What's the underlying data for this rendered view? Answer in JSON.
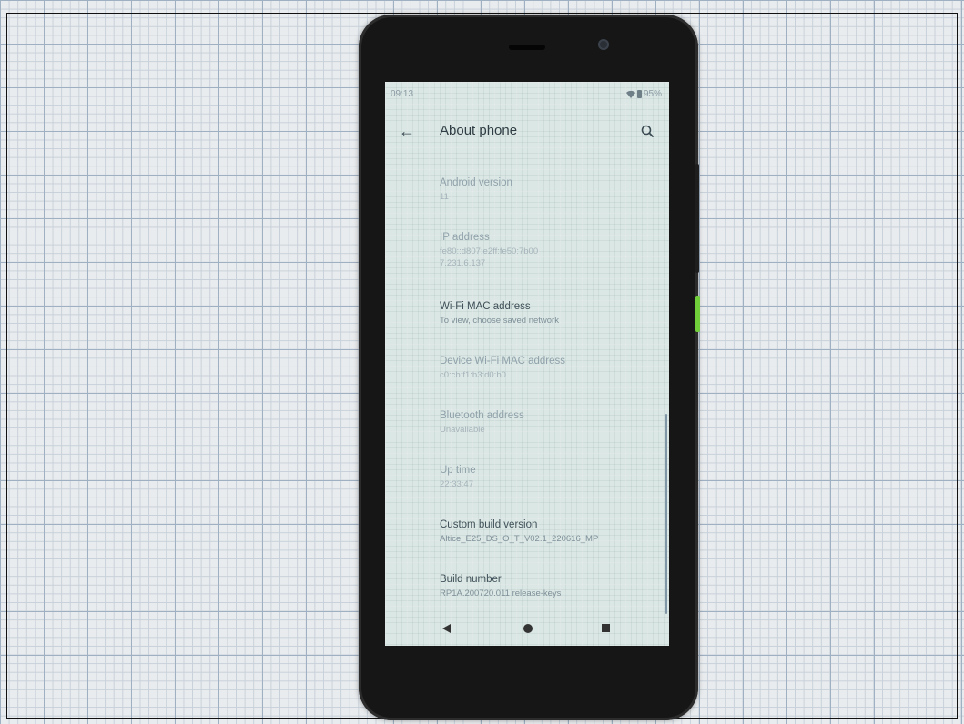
{
  "status_bar": {
    "time": "09:13",
    "battery": "95%"
  },
  "app_bar": {
    "title": "About phone"
  },
  "settings": [
    {
      "title": "Android version",
      "summary": "11"
    },
    {
      "title": "IP address",
      "summary": "fe80::d807:e2ff:fe50:7b00",
      "summary2": "7.231.6.137"
    },
    {
      "title": "Wi-Fi MAC address",
      "summary": "To view, choose saved network"
    },
    {
      "title": "Device Wi-Fi MAC address",
      "summary": "c0:cb:f1:b3:d0:b0"
    },
    {
      "title": "Bluetooth address",
      "summary": "Unavailable"
    },
    {
      "title": "Up time",
      "summary": "22:33:47"
    },
    {
      "title": "Custom build version",
      "summary": "Altice_E25_DS_O_T_V02.1_220616_MP"
    },
    {
      "title": "Build number",
      "summary": "RP1A.200720.011 release-keys"
    }
  ],
  "colors": {
    "screen_bg": "#dbe7e4",
    "phone_body": "#161616",
    "accent_button": "#6fce3a"
  }
}
